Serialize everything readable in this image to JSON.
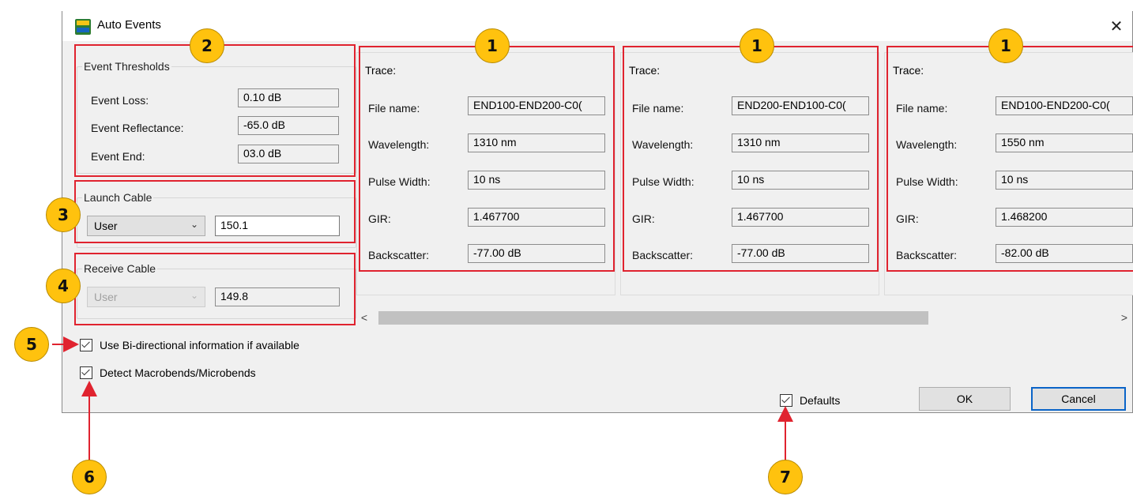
{
  "dialog": {
    "title": "Auto Events",
    "close_glyph": "✕"
  },
  "thresholds": {
    "legend": "Event Thresholds",
    "rows": [
      {
        "label": "Event Loss:",
        "value": "0.10 dB"
      },
      {
        "label": "Event Reflectance:",
        "value": "-65.0 dB"
      },
      {
        "label": "Event End:",
        "value": "03.0 dB"
      }
    ]
  },
  "launch_cable": {
    "legend": "Launch Cable",
    "mode": "User",
    "value": "150.1"
  },
  "receive_cable": {
    "legend": "Receive Cable",
    "mode": "User",
    "value": "149.8"
  },
  "traces": [
    {
      "title": "Trace:",
      "rows": [
        {
          "label": "File name:",
          "value": "END100-END200-C0("
        },
        {
          "label": "Wavelength:",
          "value": "1310 nm"
        },
        {
          "label": "Pulse Width:",
          "value": "10 ns"
        },
        {
          "label": "GIR:",
          "value": "1.467700"
        },
        {
          "label": "Backscatter:",
          "value": "-77.00 dB"
        }
      ]
    },
    {
      "title": "Trace:",
      "rows": [
        {
          "label": "File name:",
          "value": "END200-END100-C0("
        },
        {
          "label": "Wavelength:",
          "value": "1310 nm"
        },
        {
          "label": "Pulse Width:",
          "value": "10 ns"
        },
        {
          "label": "GIR:",
          "value": "1.467700"
        },
        {
          "label": "Backscatter:",
          "value": "-77.00 dB"
        }
      ]
    },
    {
      "title": "Trace:",
      "rows": [
        {
          "label": "File name:",
          "value": "END100-END200-C0("
        },
        {
          "label": "Wavelength:",
          "value": "1550 nm"
        },
        {
          "label": "Pulse Width:",
          "value": "10 ns"
        },
        {
          "label": "GIR:",
          "value": "1.468200"
        },
        {
          "label": "Backscatter:",
          "value": "-82.00 dB"
        }
      ]
    }
  ],
  "scrollbar": {
    "left_glyph": "<",
    "right_glyph": ">",
    "thumb_position": 0
  },
  "options": {
    "bidirectional": {
      "label": "Use Bi-directional information if available",
      "checked": true
    },
    "macrobends": {
      "label": "Detect Macrobends/Microbends",
      "checked": true
    },
    "defaults": {
      "label": "Defaults",
      "checked": true
    }
  },
  "buttons": {
    "ok": "OK",
    "cancel": "Cancel"
  },
  "callouts": [
    "1",
    "1",
    "1",
    "2",
    "3",
    "4",
    "5",
    "6",
    "7"
  ],
  "colors": {
    "callout_fill": "#ffc20e",
    "highlight": "#e0232f",
    "focus": "#0a64c8"
  }
}
